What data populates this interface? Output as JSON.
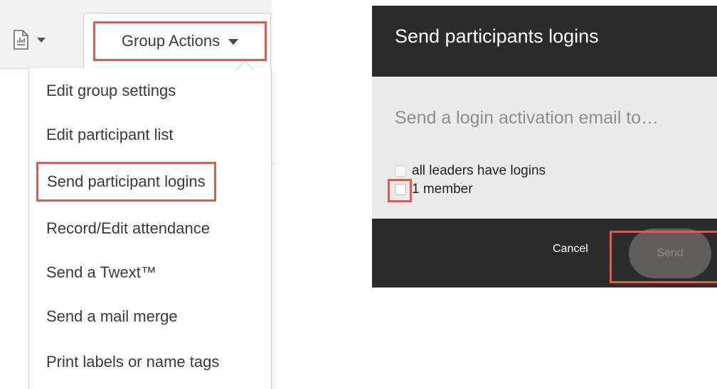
{
  "left_panel": {
    "report_button": {
      "icon": "report-document-icon"
    },
    "group_actions": {
      "label": "Group Actions"
    },
    "menu_items": [
      {
        "label": "Edit group settings"
      },
      {
        "label": "Edit participant list"
      },
      {
        "label": "Send participant logins",
        "highlighted": true
      },
      {
        "label": "Record/Edit attendance"
      },
      {
        "label": "Send a Twext™"
      },
      {
        "label": "Send a mail merge"
      },
      {
        "label": "Print labels or name tags"
      }
    ]
  },
  "dialog": {
    "title": "Send participants logins",
    "prompt": "Send a login activation email to…",
    "options": [
      {
        "label": "all leaders have logins",
        "checked": false,
        "disabled": true
      },
      {
        "label": "1 member",
        "checked": false,
        "disabled": false
      }
    ],
    "cancel_label": "Cancel",
    "send_label": "Send"
  },
  "colors": {
    "highlight": "#e05a4f",
    "dialog_dark": "#2c2b2b",
    "dialog_body": "#ebebeb",
    "send_button": "#5f5e5c"
  }
}
